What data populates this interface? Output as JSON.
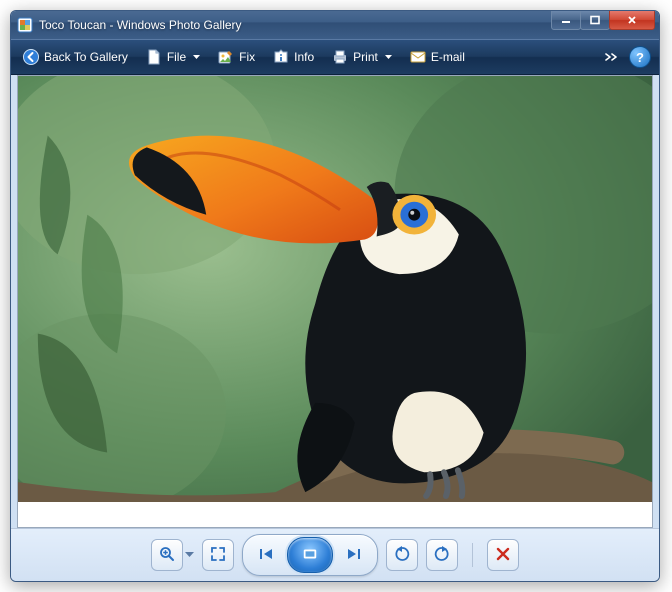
{
  "window": {
    "title": "Toco Toucan - Windows Photo Gallery"
  },
  "toolbar": {
    "back_label": "Back To Gallery",
    "file_label": "File",
    "fix_label": "Fix",
    "info_label": "Info",
    "print_label": "Print",
    "email_label": "E-mail"
  },
  "image": {
    "subject": "Toco Toucan",
    "description": "A black-bodied toucan with a large orange beak and blue eye ring perched on a branch against a blurred green jungle background."
  },
  "footer": {
    "zoom_tooltip": "Zoom",
    "fit_tooltip": "Actual size",
    "prev_tooltip": "Previous",
    "play_tooltip": "Play slide show",
    "next_tooltip": "Next",
    "rotate_ccw_tooltip": "Rotate counterclockwise",
    "rotate_cw_tooltip": "Rotate clockwise",
    "delete_tooltip": "Delete"
  }
}
